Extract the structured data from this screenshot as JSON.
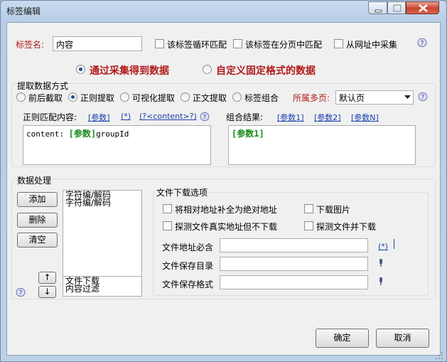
{
  "window": {
    "title": "标签编辑"
  },
  "tag": {
    "name_label": "标签名:",
    "name_value": "内容",
    "options": [
      "该标签循环匹配",
      "该标签在分页中匹配",
      "从网址中采集"
    ]
  },
  "source": {
    "option_collect": "通过采集得到数据",
    "option_fixed": "自定义固定格式的数据"
  },
  "extract": {
    "section_title": "提取数据方式",
    "modes": [
      "前后截取",
      "正则提取",
      "可视化提取",
      "正文提取",
      "标签组合"
    ],
    "multipage_label": "所属多页:",
    "multipage_value": "默认页",
    "regex_label": "正则匹配内容:",
    "regex_links": [
      "[参数]",
      "(*)",
      "(?<content>?)"
    ],
    "regex_content_prefix": "content: ",
    "regex_content_param": "[参数]",
    "regex_content_suffix": "groupId",
    "result_label": "组合结果:",
    "result_links": [
      "[参数1]",
      "[参数2]",
      "[参数N]"
    ],
    "result_content": "[参数1]"
  },
  "processing": {
    "section_title": "数据处理",
    "add_button": "添加",
    "delete_button": "删除",
    "clear_button": "清空",
    "list_items": [
      "字符编/解码",
      "字符编/解码"
    ],
    "bottom_items": [
      "文件下载",
      "内容过滤"
    ],
    "up_arrow": "↑",
    "down_arrow": "↓"
  },
  "download": {
    "section_title": "文件下载选项",
    "options": [
      "将相对地址补全为绝对地址",
      "下载图片",
      "探测文件真实地址但不下载",
      "探测文件并下载"
    ],
    "url_label": "文件地址必含",
    "url_link": "(*)",
    "dir_label": "文件保存目录",
    "format_label": "文件保存格式"
  },
  "footer": {
    "ok": "确定",
    "cancel": "取消"
  }
}
